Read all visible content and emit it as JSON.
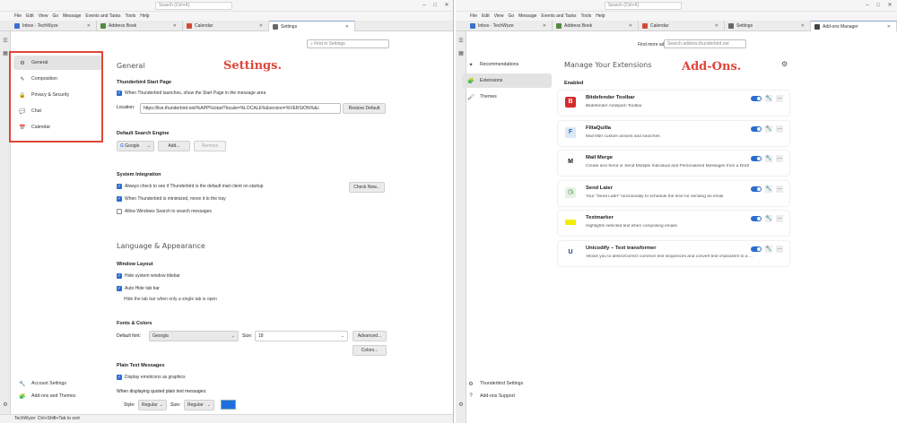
{
  "annotations": {
    "settings": "Settings.",
    "addons": "Add-Ons."
  },
  "left": {
    "search_placeholder": "Search (Ctrl+K)",
    "menu": [
      "File",
      "Edit",
      "View",
      "Go",
      "Message",
      "Events and Tasks",
      "Tools",
      "Help"
    ],
    "tabs": [
      {
        "label": "Inbox - TechWyze",
        "color": "#3b6fd1"
      },
      {
        "label": "Address Book",
        "color": "#4f8a3d"
      },
      {
        "label": "Calendar",
        "color": "#d04a3a"
      },
      {
        "label": "Settings",
        "color": "#666666"
      }
    ],
    "find_in_settings": "Find in Settings",
    "sidebar": [
      {
        "label": "General",
        "icon": "gear-icon",
        "glyph": "⚙"
      },
      {
        "label": "Composition",
        "icon": "pencil-icon",
        "glyph": "✎"
      },
      {
        "label": "Privacy & Security",
        "icon": "lock-icon",
        "glyph": "🔒"
      },
      {
        "label": "Chat",
        "icon": "chat-icon",
        "glyph": "💬"
      },
      {
        "label": "Calendar",
        "icon": "calendar-icon",
        "glyph": "📅"
      }
    ],
    "sidebar_bottom": [
      {
        "label": "Account Settings",
        "icon": "wrench-icon",
        "glyph": "🔧"
      },
      {
        "label": "Add-ons and Themes",
        "icon": "puzzle-icon",
        "glyph": "🧩"
      }
    ],
    "general": {
      "heading": "General",
      "start_page_heading": "Thunderbird Start Page",
      "start_page_check": "When Thunderbird launches, show the Start Page in the message area",
      "location_label": "Location:",
      "location_value": "https://live.thunderbird.net/%APP%/start?locale=%LOCALE%&version=%VERSION%&c",
      "restore_default": "Restore Default",
      "search_engine_heading": "Default Search Engine",
      "search_engine_value": "Google",
      "add_button": "Add...",
      "remove_button": "Remove",
      "system_heading": "System Integration",
      "system_checks": [
        {
          "label": "Always check to see if Thunderbird is the default mail client on startup",
          "on": true
        },
        {
          "label": "When Thunderbird is minimized, move it to the tray",
          "on": true
        },
        {
          "label": "Allow Windows Search to search messages",
          "on": false
        }
      ],
      "check_now": "Check Now...",
      "lang_heading": "Language & Appearance",
      "window_layout_heading": "Window Layout",
      "layout_checks": [
        {
          "label": "Hide system window titlebar",
          "on": true
        },
        {
          "label": "Auto Hide tab bar",
          "on": true
        }
      ],
      "layout_hint": "Hide the tab bar when only a single tab is open",
      "fonts_heading": "Fonts & Colors",
      "default_font_label": "Default font:",
      "default_font_value": "Georgia",
      "size_label": "Size:",
      "size_value": "18",
      "advanced_button": "Advanced...",
      "colors_button": "Colors...",
      "plain_text_heading": "Plain Text Messages",
      "emoticons_check": "Display emoticons as graphics",
      "quoted_label": "When displaying quoted plain text messages:",
      "style_label": "Style:",
      "style_value": "Regular",
      "size2_label": "Size:",
      "size2_value": "Regular"
    },
    "status": "TechWyze: Ctrl+Shift+Tab to sort"
  },
  "right": {
    "search_placeholder": "Search (Ctrl+K)",
    "menu": [
      "File",
      "Edit",
      "View",
      "Go",
      "Message",
      "Events and Tasks",
      "Tools",
      "Help"
    ],
    "tabs": [
      {
        "label": "Inbox - TechWyze",
        "color": "#3b6fd1"
      },
      {
        "label": "Address Book",
        "color": "#4f8a3d"
      },
      {
        "label": "Calendar",
        "color": "#d04a3a"
      },
      {
        "label": "Settings",
        "color": "#666666"
      },
      {
        "label": "Add-ons Manager",
        "color": "#444444"
      }
    ],
    "find_more_label": "Find more add-ons",
    "find_more_placeholder": "Search addons.thunderbird.net",
    "sidebar": [
      {
        "label": "Recommendations",
        "icon": "recommendations-icon",
        "glyph": "✦"
      },
      {
        "label": "Extensions",
        "icon": "puzzle-icon",
        "glyph": "🧩"
      },
      {
        "label": "Themes",
        "icon": "brush-icon",
        "glyph": "🖌"
      }
    ],
    "sidebar_bottom": [
      {
        "label": "Thunderbird Settings",
        "icon": "gear-icon",
        "glyph": "⚙"
      },
      {
        "label": "Add-ons Support",
        "icon": "help-icon",
        "glyph": "?"
      }
    ],
    "heading": "Manage Your Extensions",
    "enabled_label": "Enabled",
    "extensions": [
      {
        "name": "Bitdefender Toolbar",
        "desc": "Bitdefender Antispam Toolbar",
        "glyph": "B",
        "bg": "#d52b2b",
        "fg": "#ffffff"
      },
      {
        "name": "FiltaQuilla",
        "desc": "Mail filter custom actions and searches",
        "glyph": "F",
        "bg": "#dce8f5",
        "fg": "#2b6ccf"
      },
      {
        "name": "Mail Merge",
        "desc": "Create and Send or Send Multiple Individual and Personalized Messages from a Draft",
        "glyph": "M",
        "bg": "#ffffff",
        "fg": "#111111"
      },
      {
        "name": "Send Later",
        "desc": "Your \"Send Later\" functionality to schedule the time for sending an email",
        "glyph": "◷",
        "bg": "#e6f2e3",
        "fg": "#2f7d32"
      },
      {
        "name": "Textmarker",
        "desc": "Highlights selected text when composing emails",
        "glyph": "",
        "bg": "#f2ee00",
        "fg": "#333333"
      },
      {
        "name": "Unicodify – Text transformer",
        "desc": "Allows you to detect/correct common text sequences and convert text characters to a ...",
        "glyph": "U",
        "bg": "#ffffff",
        "fg": "#1e3f8a"
      }
    ]
  }
}
